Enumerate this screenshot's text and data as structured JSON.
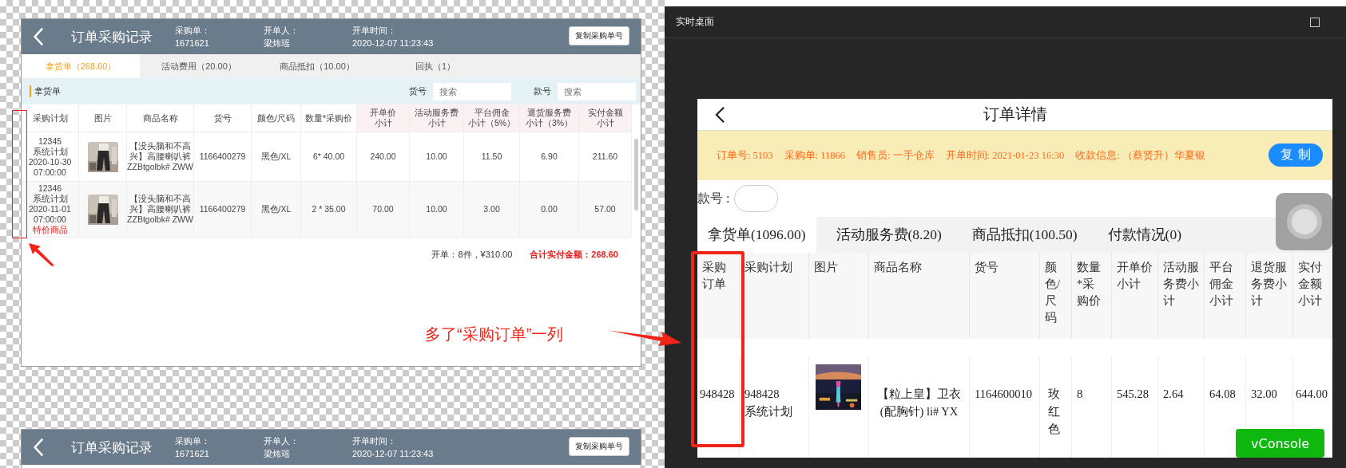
{
  "record_panels": [
    {
      "header": {
        "title": "订单采购记录",
        "fields": [
          {
            "label": "采购单：",
            "value": "1671621"
          },
          {
            "label": "开单人：",
            "value": "梁炜瑶"
          },
          {
            "label": "开单时间：",
            "value": "2020-12-07 11:23:43"
          }
        ],
        "button": "复制采购单号"
      },
      "tabs": [
        {
          "label": "拿货单（268.60）",
          "selected": true
        },
        {
          "label": "活动费用（20.00）",
          "selected": false
        },
        {
          "label": "商品抵扣（10.00）",
          "selected": false
        },
        {
          "label": "回执（1）",
          "selected": false
        }
      ],
      "filter": {
        "title": "拿货单",
        "fields": [
          {
            "label": "货号",
            "placeholder": "搜索"
          },
          {
            "label": "款号",
            "placeholder": "搜索"
          }
        ]
      },
      "columns": [
        {
          "lines": [
            "采购计划"
          ],
          "tinted": false
        },
        {
          "lines": [
            "图片"
          ],
          "tinted": false
        },
        {
          "lines": [
            "商品名称"
          ],
          "tinted": false
        },
        {
          "lines": [
            "货号"
          ],
          "tinted": false
        },
        {
          "lines": [
            "颜色/尺码"
          ],
          "tinted": false
        },
        {
          "lines": [
            "数量*采购价"
          ],
          "tinted": false
        },
        {
          "lines": [
            "开单价",
            "小计"
          ],
          "tinted": true
        },
        {
          "lines": [
            "活动服务费",
            "小计"
          ],
          "tinted": true
        },
        {
          "lines": [
            "平台佣金",
            "小计（5%）"
          ],
          "tinted": true
        },
        {
          "lines": [
            "退货服务费",
            "小计（3%）"
          ],
          "tinted": true
        },
        {
          "lines": [
            "实付金额",
            "小计"
          ],
          "tinted": true
        }
      ],
      "rows": [
        {
          "cells": [
            {
              "lines": [
                "12345",
                "系统计划",
                "2020-10-30",
                "07:00:00"
              ]
            },
            {
              "kind": "picture"
            },
            {
              "lines": [
                "【没头脑和不高",
                "兴】高腰喇叭裤",
                "ZZBtgolbk# ZWW"
              ]
            },
            {
              "lines": [
                "1166400279"
              ]
            },
            {
              "lines": [
                "黑色/XL"
              ]
            },
            {
              "lines": [
                "6* 40.00"
              ]
            },
            {
              "lines": [
                "240.00"
              ]
            },
            {
              "lines": [
                "10.00"
              ]
            },
            {
              "lines": [
                "11.50"
              ]
            },
            {
              "lines": [
                "6.90"
              ]
            },
            {
              "lines": [
                "211.60"
              ]
            }
          ]
        },
        {
          "cells": [
            {
              "lines": [
                "12346",
                "系统计划",
                "2020-11-01",
                "07:00:00"
              ],
              "tag": "特价商品"
            },
            {
              "kind": "picture"
            },
            {
              "lines": [
                "【没头脑和不高",
                "兴】高腰喇叭裤",
                "ZZBtgolbk# ZWW"
              ]
            },
            {
              "lines": [
                "1166400279"
              ]
            },
            {
              "lines": [
                "黑色/XL"
              ]
            },
            {
              "lines": [
                "2 * 35.00"
              ]
            },
            {
              "lines": [
                "70.00"
              ]
            },
            {
              "lines": [
                "10.00"
              ]
            },
            {
              "lines": [
                "3.00"
              ]
            },
            {
              "lines": [
                "0.00"
              ]
            },
            {
              "lines": [
                "57.00"
              ]
            }
          ]
        }
      ],
      "summary": {
        "count": "开单：8件，¥310.00",
        "total": "合计实付金额：268.60"
      }
    },
    {
      "header": {
        "title": "订单采购记录",
        "fields": [
          {
            "label": "采购单：",
            "value": "1671621"
          },
          {
            "label": "开单人：",
            "value": "梁炜瑶"
          },
          {
            "label": "开单时间：",
            "value": "2020-12-07 11:23:43"
          }
        ],
        "button": "复制采购单号"
      }
    }
  ],
  "remote_window": {
    "title": "实时桌面",
    "screen": {
      "title": "订单详情",
      "info": [
        "订单号: 5103",
        "采购单: 11866",
        "销售员: 一手仓库",
        "开单时间: 2021-01-23 16:30",
        "收款信息: （蔡贤升）华夏银"
      ],
      "copy_button": "复 制",
      "search": {
        "label": "款号 :"
      },
      "tabs": [
        {
          "label": "拿货单(1096.00)",
          "selected": true
        },
        {
          "label": "活动服务费(8.20)",
          "selected": false
        },
        {
          "label": "商品抵扣(100.50)",
          "selected": false
        },
        {
          "label": "付款情况(0)",
          "selected": false
        }
      ],
      "columns": [
        "采购订单",
        "采购计划",
        "图片",
        "商品名称",
        "货号",
        "颜色/尺码",
        "数量*采购价",
        "开单价小计",
        "活动服务费小计",
        "平台佣金小计",
        "退货服务费小计",
        "实付金额小计"
      ],
      "rows": [
        {
          "cells": [
            {
              "text": "948428"
            },
            {
              "text": "948428\n系统计划"
            },
            {
              "kind": "picture"
            },
            {
              "text": "【粒上皇】卫衣(配胸针) li# YX"
            },
            {
              "text": "1164600010"
            },
            {
              "text": "玫红色"
            },
            {
              "text": "8"
            },
            {
              "text": "545.28"
            },
            {
              "text": "2.64"
            },
            {
              "text": "64.08"
            },
            {
              "text": "32.00"
            },
            {
              "text": "644.00"
            }
          ]
        }
      ],
      "console_button": "vConsole"
    }
  },
  "annotation": {
    "text": "多了“采购订单”一列"
  }
}
